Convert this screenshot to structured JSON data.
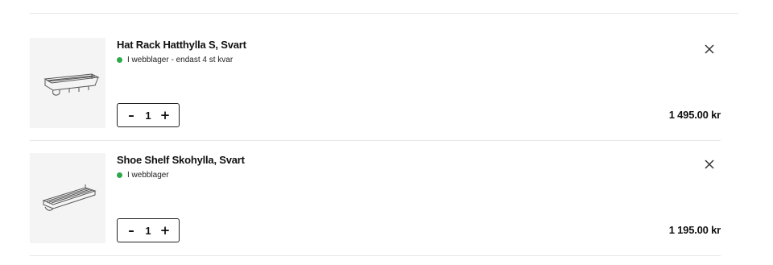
{
  "cart": {
    "items": [
      {
        "name": "Hat Rack Hatthylla S, Svart",
        "stock_text": "I webblager - endast 4 st kvar",
        "stock_status_color": "#2ea84a",
        "quantity": "1",
        "decrement_label": "–",
        "increment_label": "+",
        "price": "1 495.00 kr",
        "image_icon": "hat-rack-product-image",
        "remove_icon": "close-icon"
      },
      {
        "name": "Shoe Shelf Skohylla, Svart",
        "stock_text": "I webblager",
        "stock_status_color": "#2ea84a",
        "quantity": "1",
        "decrement_label": "–",
        "increment_label": "+",
        "price": "1 195.00 kr",
        "image_icon": "shoe-shelf-product-image",
        "remove_icon": "close-icon"
      }
    ]
  }
}
